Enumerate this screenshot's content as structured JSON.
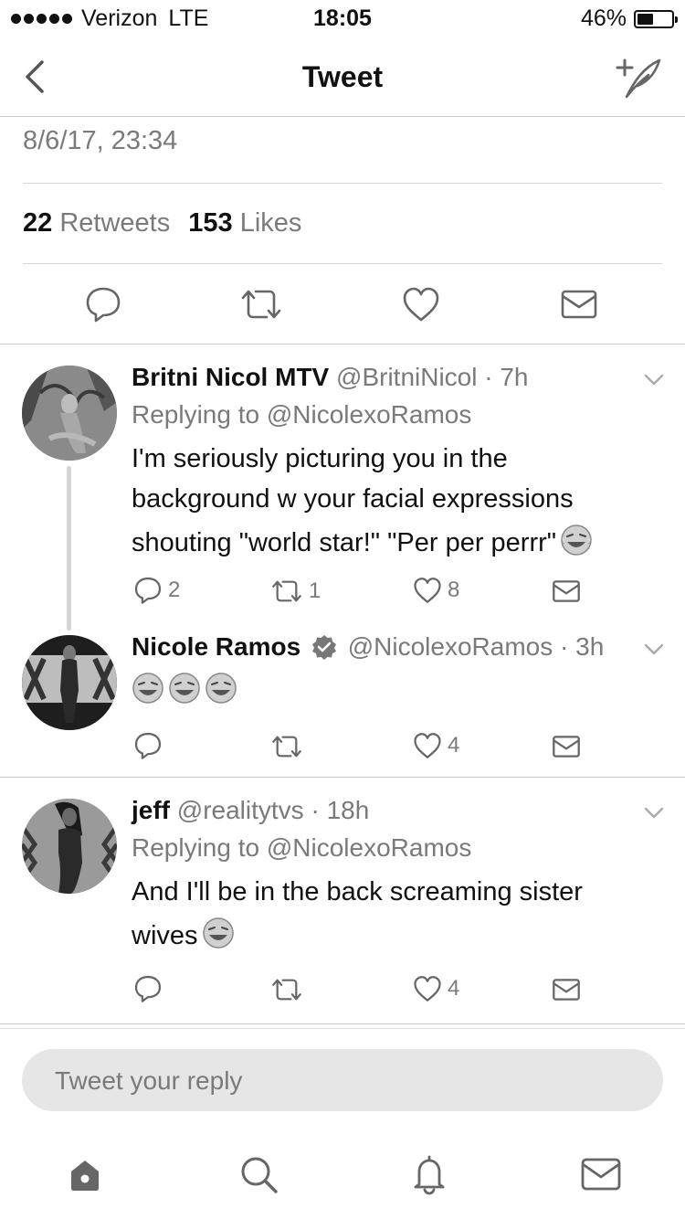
{
  "status_bar": {
    "carrier": "Verizon",
    "network": "LTE",
    "time": "18:05",
    "battery_percent": "46%",
    "battery_level": 0.46
  },
  "nav": {
    "title": "Tweet",
    "back_icon": "chevron-left-icon",
    "compose_icon": "compose-tweet-icon"
  },
  "tweet": {
    "timestamp": "8/6/17, 23:34",
    "retweets_count": "22",
    "retweets_label": "Retweets",
    "likes_count": "153",
    "likes_label": "Likes",
    "actions": [
      "reply-icon",
      "retweet-icon",
      "like-icon",
      "message-icon"
    ]
  },
  "replies": [
    {
      "name": "Britni Nicol MTV",
      "handle": "@BritniNicol",
      "time": "7h",
      "replying_to": "Replying to @NicolexoRamos",
      "lines": [
        "I'm seriously picturing you in the",
        "background w your facial expressions",
        "shouting \"world star!\" \"Per per perrr\""
      ],
      "reply_count": "2",
      "retweet_count": "1",
      "like_count": "8"
    },
    {
      "name": "Nicole Ramos",
      "verified": true,
      "handle": "@NicolexoRamos",
      "time": "3h",
      "reply_count": "",
      "retweet_count": "",
      "like_count": "4"
    },
    {
      "name": "jeff",
      "handle": "@realitytvs",
      "time": "18h",
      "replying_to": "Replying to @NicolexoRamos",
      "lines": [
        "And I'll be in the back screaming sister",
        "wives"
      ],
      "reply_count": "",
      "retweet_count": "",
      "like_count": "4"
    }
  ],
  "reply_input": {
    "placeholder": "Tweet your reply"
  },
  "tab_bar": [
    "home-icon",
    "search-icon",
    "notifications-icon",
    "messages-icon"
  ]
}
